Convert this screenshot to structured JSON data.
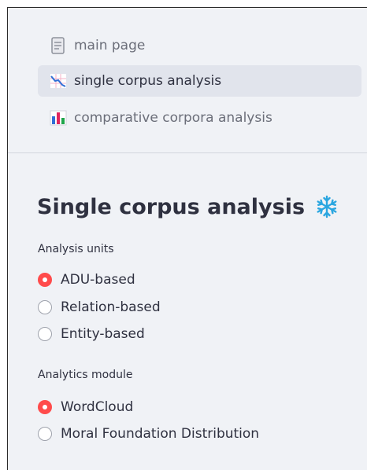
{
  "sidebar": {
    "items": [
      {
        "label": "main page",
        "icon": "page-icon",
        "active": false
      },
      {
        "label": "single corpus analysis",
        "icon": "chart-decreasing-icon",
        "active": true
      },
      {
        "label": "comparative corpora analysis",
        "icon": "bar-chart-icon",
        "active": false
      }
    ]
  },
  "main": {
    "title": "Single corpus analysis",
    "title_icon": "snowflake-icon",
    "analysis_units": {
      "label": "Analysis units",
      "options": [
        "ADU-based",
        "Relation-based",
        "Entity-based"
      ],
      "selected": "ADU-based"
    },
    "analytics_module": {
      "label": "Analytics module",
      "options": [
        "WordCloud",
        "Moral Foundation Distribution"
      ],
      "selected": "WordCloud"
    }
  },
  "colors": {
    "accent": "#ff4b4b",
    "sidebar_bg": "#f0f2f6",
    "active_item_bg": "#e1e4ec",
    "snowflake": "#2aa6e0"
  }
}
